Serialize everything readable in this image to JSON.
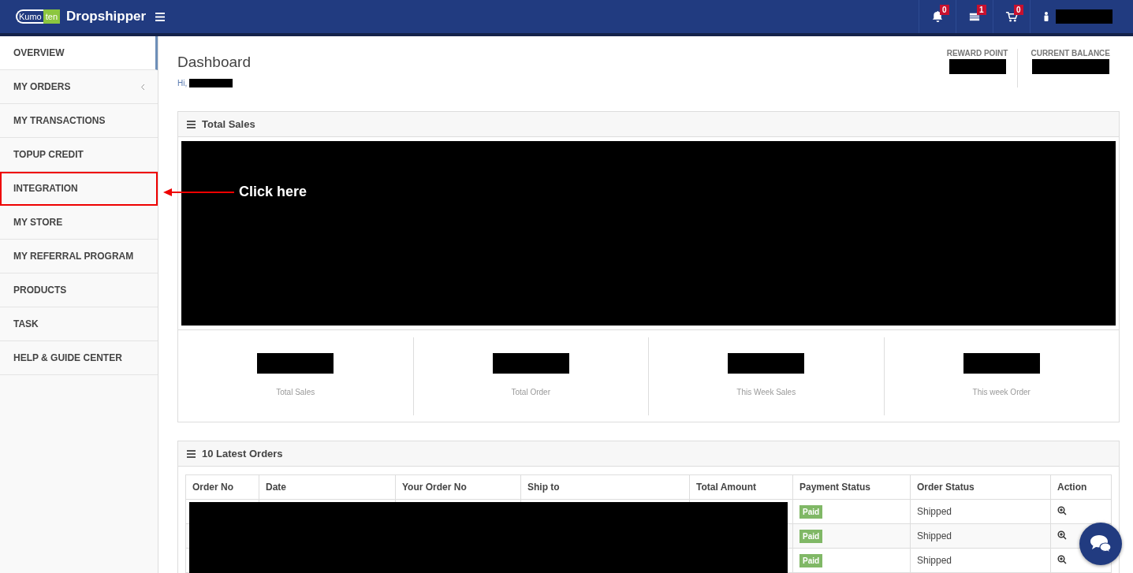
{
  "header": {
    "logo": {
      "part1": "Kumo",
      "part2": "ten"
    },
    "brand": "Dropshipper",
    "notifications": [
      {
        "kind": "bell",
        "count": "0"
      },
      {
        "kind": "messages",
        "count": "1"
      },
      {
        "kind": "cart",
        "count": "0"
      }
    ]
  },
  "sidebar": {
    "items": [
      {
        "label": "OVERVIEW",
        "selected": true,
        "highlighted": false,
        "has_submenu": false
      },
      {
        "label": "MY ORDERS",
        "selected": false,
        "highlighted": false,
        "has_submenu": true
      },
      {
        "label": "MY TRANSACTIONS",
        "selected": false,
        "highlighted": false,
        "has_submenu": false
      },
      {
        "label": "TOPUP CREDIT",
        "selected": false,
        "highlighted": false,
        "has_submenu": false
      },
      {
        "label": "INTEGRATION",
        "selected": false,
        "highlighted": true,
        "has_submenu": false
      },
      {
        "label": "MY STORE",
        "selected": false,
        "highlighted": false,
        "has_submenu": false
      },
      {
        "label": "MY REFERRAL PROGRAM",
        "selected": false,
        "highlighted": false,
        "has_submenu": false
      },
      {
        "label": "PRODUCTS",
        "selected": false,
        "highlighted": false,
        "has_submenu": false
      },
      {
        "label": "TASK",
        "selected": false,
        "highlighted": false,
        "has_submenu": false
      },
      {
        "label": "HELP & GUIDE CENTER",
        "selected": false,
        "highlighted": false,
        "has_submenu": false
      }
    ]
  },
  "annotation": {
    "text": "Click here"
  },
  "page": {
    "title": "Dashboard",
    "greeting": "Hi,",
    "summary": [
      {
        "label": "REWARD POINT"
      },
      {
        "label": "CURRENT BALANCE"
      }
    ]
  },
  "sales_panel": {
    "title": "Total Sales",
    "stats": [
      {
        "label": "Total Sales"
      },
      {
        "label": "Total Order"
      },
      {
        "label": "This Week Sales"
      },
      {
        "label": "This week Order"
      }
    ]
  },
  "orders_panel": {
    "title": "10 Latest Orders",
    "table": {
      "columns": [
        "Order No",
        "Date",
        "Your Order No",
        "Ship to",
        "Total Amount",
        "Payment Status",
        "Order Status",
        "Action"
      ],
      "rows": [
        {
          "payment_status": "Paid",
          "order_status": "Shipped"
        },
        {
          "payment_status": "Paid",
          "order_status": "Shipped"
        },
        {
          "payment_status": "Paid",
          "order_status": "Shipped"
        }
      ]
    }
  }
}
